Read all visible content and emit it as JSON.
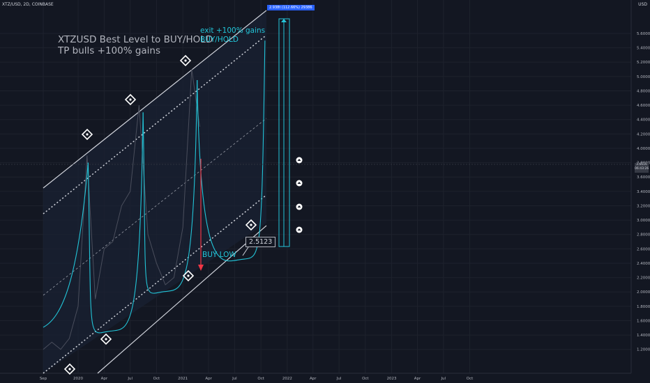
{
  "chart_data": {
    "type": "line",
    "symbol_label": "XTZ/USD, 2D, COINBASE",
    "currency": "USD",
    "headline": [
      "XTZUSD Best Level to BUY/HOLD",
      "TP bulls +100% gains"
    ],
    "exit_note": [
      "exit +100% gains",
      "BUY/HOLD"
    ],
    "buy_note": "BUY LOW",
    "level_badge": "2.5123",
    "measure_label": "2.938t (112.66%) 29386",
    "last_price": [
      "3.6616",
      "06:43:26"
    ],
    "x_ticks": [
      "Sep",
      "2020",
      "Apr",
      "Jul",
      "Oct",
      "2021",
      "Apr",
      "Jul",
      "Oct",
      "2022",
      "Apr",
      "Jul",
      "Oct",
      "2023",
      "Apr",
      "Jul",
      "Oct"
    ],
    "y_ticks": [
      "5.6000",
      "5.4000",
      "5.2000",
      "5.0000",
      "4.8000",
      "4.6000",
      "4.4000",
      "4.2000",
      "4.0000",
      "3.8000",
      "3.6000",
      "3.4000",
      "3.2000",
      "3.0000",
      "2.8000",
      "2.6000",
      "2.4000",
      "2.2000",
      "2.0000",
      "1.8000",
      "1.6000",
      "1.4000",
      "1.2000"
    ],
    "ylim": [
      1.1,
      5.9
    ],
    "grid": true,
    "colors": {
      "background": "#131722",
      "price": "#4a4e5c",
      "curve": "#22c5d8",
      "channel": "#d1d4dc",
      "arrow": "#f23645",
      "measure": "#2962ff"
    },
    "series": [
      {
        "x": [
          "2019-09-01",
          "2019-10-01",
          "2019-11-01",
          "2019-12-01",
          "2020-01-01",
          "2020-02-01",
          "2020-03-01",
          "2020-04-01",
          "2020-05-01",
          "2020-06-01",
          "2020-07-01",
          "2020-08-01",
          "2020-09-01",
          "2020-10-01",
          "2020-11-01",
          "2020-12-01",
          "2021-01-01",
          "2021-02-01",
          "2021-03-01"
        ],
        "values": [
          1.2,
          1.3,
          1.2,
          1.35,
          1.8,
          3.9,
          1.9,
          2.6,
          2.7,
          3.2,
          3.4,
          4.6,
          2.8,
          2.4,
          2.1,
          2.2,
          2.9,
          5.1,
          4.3
        ]
      }
    ],
    "wave_lows": [
      {
        "x": "2020-04-15",
        "y": 1.45
      },
      {
        "x": "2020-10-20",
        "y": 2.0
      },
      {
        "x": "2021-07-20",
        "y": 2.45
      }
    ],
    "wave_peaks": [
      {
        "x": "2020-02-05",
        "y": 3.8
      },
      {
        "x": "2020-08-15",
        "y": 4.5
      },
      {
        "x": "2021-02-20",
        "y": 4.95
      },
      {
        "x": "2021-10-15",
        "y": 5.5
      }
    ]
  }
}
